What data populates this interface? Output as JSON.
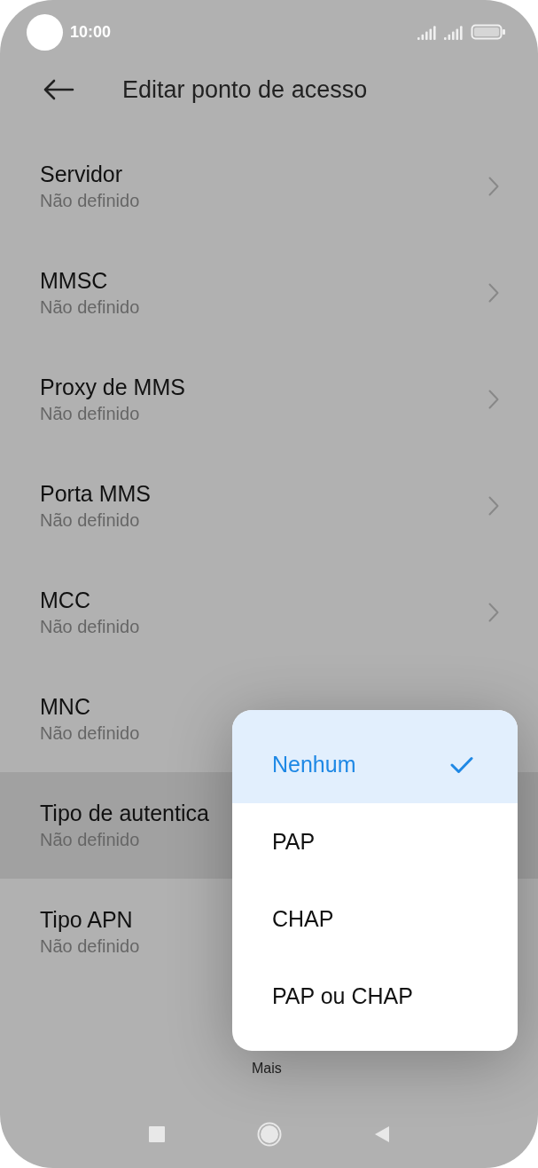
{
  "status_bar": {
    "time": "10:00"
  },
  "header": {
    "title": "Editar ponto de acesso"
  },
  "settings": [
    {
      "title": "Servidor",
      "value": "Não definido",
      "chevron": true,
      "selected": false
    },
    {
      "title": "MMSC",
      "value": "Não definido",
      "chevron": true,
      "selected": false
    },
    {
      "title": "Proxy de MMS",
      "value": "Não definido",
      "chevron": true,
      "selected": false
    },
    {
      "title": "Porta MMS",
      "value": "Não definido",
      "chevron": true,
      "selected": false
    },
    {
      "title": "MCC",
      "value": "Não definido",
      "chevron": true,
      "selected": false
    },
    {
      "title": "MNC",
      "value": "Não definido",
      "chevron": false,
      "selected": false
    },
    {
      "title": "Tipo de autentica",
      "value": "Não definido",
      "chevron": false,
      "selected": true
    },
    {
      "title": "Tipo APN",
      "value": "Não definido",
      "chevron": false,
      "selected": false
    }
  ],
  "more_button": "Mais",
  "popup_menu": {
    "items": [
      {
        "label": "Nenhum",
        "selected": true
      },
      {
        "label": "PAP",
        "selected": false
      },
      {
        "label": "CHAP",
        "selected": false
      },
      {
        "label": "PAP ou CHAP",
        "selected": false
      }
    ]
  }
}
